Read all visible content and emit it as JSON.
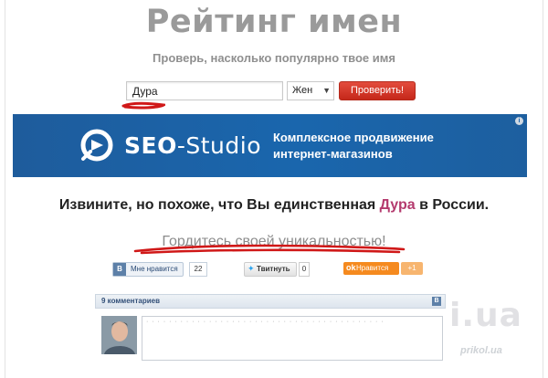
{
  "header": {
    "title": "Рейтинг имен",
    "subtitle": "Проверь, насколько популярно твое имя"
  },
  "form": {
    "name_value": "Дура",
    "gender_value": "Жен",
    "submit_label": "Проверить!"
  },
  "banner": {
    "logo_text_bold": "SEO",
    "logo_text_rest": "-Studio",
    "tagline_line1": "Комплексное продвижение",
    "tagline_line2": "интернет-магазинов",
    "info_glyph": "i"
  },
  "result": {
    "text_before": "Извините, но похоже, что Вы единственная ",
    "name": "Дура",
    "text_after": " в России.",
    "proud_text": "Гордитесь своей уникальностью!",
    "highlight_color": "#b43a6e"
  },
  "social": {
    "vk": {
      "logo": "B",
      "label": "Мне нравится",
      "count": "22"
    },
    "twitter": {
      "label": "Твитнуть",
      "count": "0"
    },
    "ok": {
      "logo": "ok",
      "label": "Нравится",
      "count": "+1"
    }
  },
  "comments": {
    "count_label": "9 комментариев",
    "vk_logo": "B",
    "placeholder_dots": "· · · · · · · · · · · · · · · · · · · · · · · · · · · · · · · · · · · · · · · · · ·"
  },
  "watermark": {
    "large": "i.ua",
    "site": "prikol.ua"
  },
  "colors": {
    "accent_red": "#c5281a",
    "banner_blue": "#1a66ad",
    "scribble_red": "#d01818"
  }
}
